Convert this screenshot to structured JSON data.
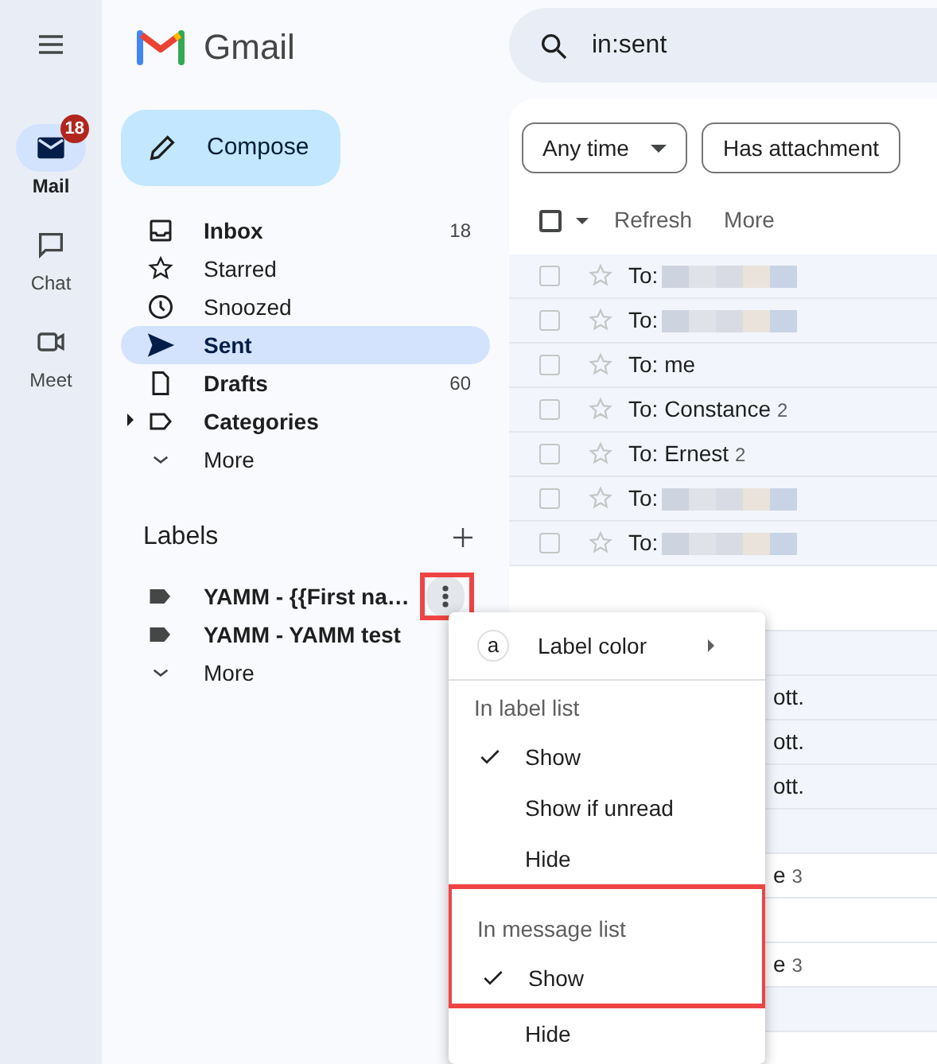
{
  "rail": [
    {
      "kind": "mail",
      "label": "Mail",
      "selected": true,
      "badge": "18"
    },
    {
      "kind": "chat",
      "label": "Chat",
      "selected": false
    },
    {
      "kind": "meet",
      "label": "Meet",
      "selected": false
    }
  ],
  "app_name": "Gmail",
  "compose": "Compose",
  "nav": [
    {
      "kind": "inbox",
      "label": "Inbox",
      "count": "18",
      "unread": true,
      "selected": false
    },
    {
      "kind": "starred",
      "label": "Starred",
      "unread": false,
      "selected": false
    },
    {
      "kind": "snoozed",
      "label": "Snoozed",
      "unread": false,
      "selected": false
    },
    {
      "kind": "sent",
      "label": "Sent",
      "unread": true,
      "selected": true
    },
    {
      "kind": "drafts",
      "label": "Drafts",
      "count": "60",
      "unread": true,
      "selected": false
    },
    {
      "kind": "categories",
      "label": "Categories",
      "unread": true,
      "selected": false,
      "expanded": false
    },
    {
      "kind": "more",
      "label": "More",
      "unread": false,
      "selected": false
    }
  ],
  "labels": {
    "title": "Labels",
    "items": [
      {
        "label": "YAMM - {{First na…",
        "options_open": true,
        "highlighted": true
      },
      {
        "label": "YAMM - YAMM test",
        "options_open": false,
        "highlighted": false
      }
    ],
    "more": "More"
  },
  "search": {
    "value": "in:sent"
  },
  "filters": [
    {
      "label": "Any time",
      "dropdown": true
    },
    {
      "label": "Has attachment",
      "dropdown": false
    }
  ],
  "toolbar": {
    "checked": false,
    "refresh": "Refresh",
    "more": "More"
  },
  "messages": [
    {
      "kind": "blurred",
      "prefix": "To:",
      "read": true
    },
    {
      "kind": "blurred",
      "prefix": "To:",
      "read": true
    },
    {
      "kind": "text",
      "text": "To: me",
      "read": true
    },
    {
      "kind": "text",
      "text": "To: Constance",
      "count": "2",
      "read": true
    },
    {
      "kind": "text",
      "text": "To: Ernest",
      "count": "2",
      "read": true
    },
    {
      "kind": "blurred",
      "prefix": "To:",
      "read": true
    },
    {
      "kind": "blurred",
      "prefix": "To:",
      "read": true
    }
  ],
  "covered_messages": [
    {
      "read": false
    },
    {
      "read": true
    },
    {
      "snippet": "ott.",
      "read": true
    },
    {
      "snippet": "ott.",
      "read": true
    },
    {
      "snippet": "ott.",
      "read": true
    },
    {
      "read": true
    },
    {
      "snippet": "e",
      "count": "3",
      "read": false
    },
    {
      "read": false
    },
    {
      "snippet": "e",
      "count": "3",
      "read": false
    },
    {
      "read": true
    },
    {
      "read": false
    }
  ],
  "menu": [
    {
      "kind": "color",
      "label": "Label color",
      "swatch": "a",
      "highlighted": false
    },
    {
      "kind": "header",
      "label": "In label list",
      "highlighted": false
    },
    {
      "kind": "option",
      "label": "Show",
      "checked": true,
      "highlighted": false
    },
    {
      "kind": "option",
      "label": "Show if unread",
      "checked": false,
      "highlighted": false
    },
    {
      "kind": "option",
      "label": "Hide",
      "checked": false,
      "highlighted": false
    },
    {
      "kind": "header",
      "label": "In message list",
      "highlighted": true
    },
    {
      "kind": "option",
      "label": "Show",
      "checked": true,
      "highlighted": true
    },
    {
      "kind": "option",
      "label": "Hide",
      "checked": false,
      "highlighted": false
    }
  ]
}
